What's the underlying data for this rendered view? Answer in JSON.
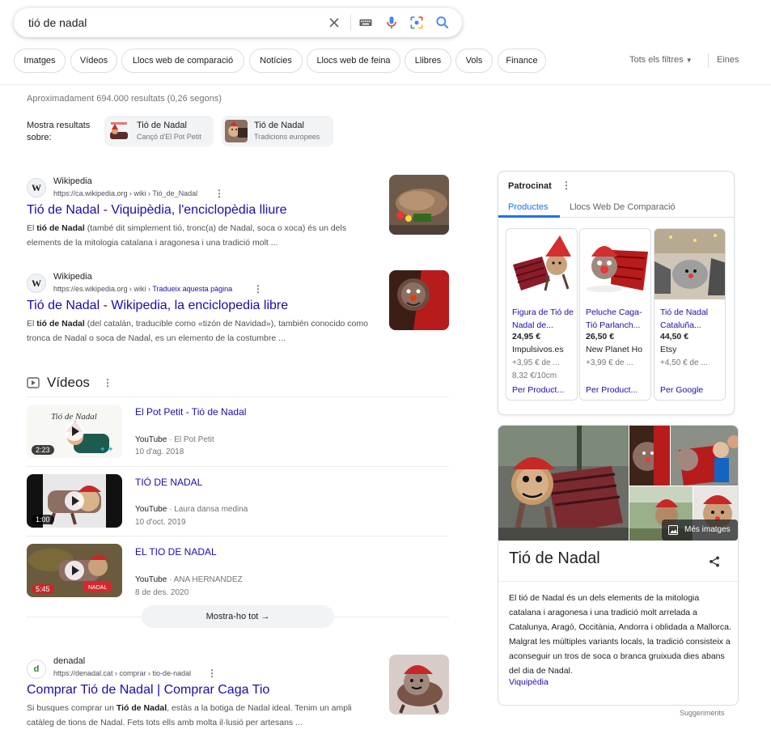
{
  "search": {
    "query": "tió de nadal"
  },
  "chips": [
    "Imatges",
    "Vídeos",
    "Llocs web de comparació",
    "Notícies",
    "Llocs web de feina",
    "Llibres",
    "Vols",
    "Finance"
  ],
  "filters_label": "Tots els filtres",
  "tools_label": "Eines",
  "stats": "Aproximadament 694.000 resultats (0,26 segons)",
  "show_results_about": "Mostra resultats sobre:",
  "entities": [
    {
      "title": "Tió de Nadal",
      "subtitle": "Cançó d'El Pot Petit"
    },
    {
      "title": "Tió de Nadal",
      "subtitle": "Tradicions europees"
    }
  ],
  "results": [
    {
      "favicon": "W",
      "site": "Wikipedia",
      "url": "https://ca.wikipedia.org › wiki › Tió_de_Nadal",
      "title": "Tió de Nadal - Viquipèdia, l'enciclopèdia lliure",
      "snippet_bold": "tió de Nadal",
      "snippet_pre": "El ",
      "snippet_post": " (també dit simplement tió, tronc(a) de Nadal, soca o xoca) és un dels elements de la mitologia catalana i aragonesa i una tradició molt ..."
    },
    {
      "favicon": "W",
      "site": "Wikipedia",
      "url": "https://es.wikipedia.org › wiki",
      "translate": "Tradueix aquesta pàgina",
      "title": "Tió de Nadal - Wikipedia, la enciclopedia libre",
      "snippet_bold": "tió de Nadal",
      "snippet_pre": "El ",
      "snippet_post": " (del catalán, traducible como «tizón de Navidad»), también conocido como tronca de Nadal o soca de Nadal, es un elemento de la costumbre ..."
    },
    {
      "favicon": "d",
      "site": "denadal",
      "url": "https://denadal.cat › comprar › tio-de-nadal",
      "title": "Comprar Tió de Nadal | Comprar Caga Tio",
      "snippet_bold": "Tió de Nadal",
      "snippet_pre": "Si busques comprar un ",
      "snippet_post": ", estàs a la botiga de Nadal ideal. Tenim un ampli catàleg de tions de Nadal. Fets tots ells amb molta il·lusió per artesans ..."
    }
  ],
  "videos": {
    "heading": "Vídeos",
    "items": [
      {
        "title": "El Pot Petit - Tió de Nadal",
        "source": "YouTube",
        "channel": "El Pot Petit",
        "date": "10 d'ag. 2018",
        "duration": "2:23"
      },
      {
        "title": "TIÓ DE NADAL",
        "source": "YouTube",
        "channel": "Laura dansa medina",
        "date": "10 d'oct. 2019",
        "duration": "1:00"
      },
      {
        "title": "EL TIO DE NADAL",
        "source": "YouTube",
        "channel": "ANA HERNANDEZ",
        "date": "8 de des. 2020",
        "duration": "5:45"
      }
    ],
    "show_all": "Mostra-ho tot"
  },
  "sponsored": {
    "label": "Patrocinat",
    "tabs": [
      "Productes",
      "Llocs Web De Comparació"
    ],
    "products": [
      {
        "name": "Figura de Tió de Nadal de...",
        "price": "24,95 €",
        "store": "Impulsivos.es",
        "shipping": "+3,95 € de ...",
        "unit": "8,32 €/10cm",
        "by": "Per Product..."
      },
      {
        "name": "Peluche Caga-Tió Parlanch...",
        "price": "26,50 €",
        "store": "New Planet Ho",
        "shipping": "+3,99 € de ...",
        "unit": "",
        "by": "Per Product..."
      },
      {
        "name": "Tió de Nadal Cataluña...",
        "price": "44,50 €",
        "store": "Etsy",
        "shipping": "+4,50 € de ...",
        "unit": "",
        "by": "Per Google"
      }
    ]
  },
  "knowledge": {
    "more_images": "Més imatges",
    "title": "Tió de Nadal",
    "description": "El tió de Nadal és un dels elements de la mitologia catalana i aragonesa i una tradició molt arrelada a Catalunya, Aragó, Occitània, Andorra i oblidada a Mallorca. Malgrat les múltiples variants locals, la tradició consisteix a aconseguir un tros de soca o branca gruixuda dies abans del dia de Nadal.",
    "source": "Viquipèdia"
  },
  "suggestions": "Suggeriments"
}
